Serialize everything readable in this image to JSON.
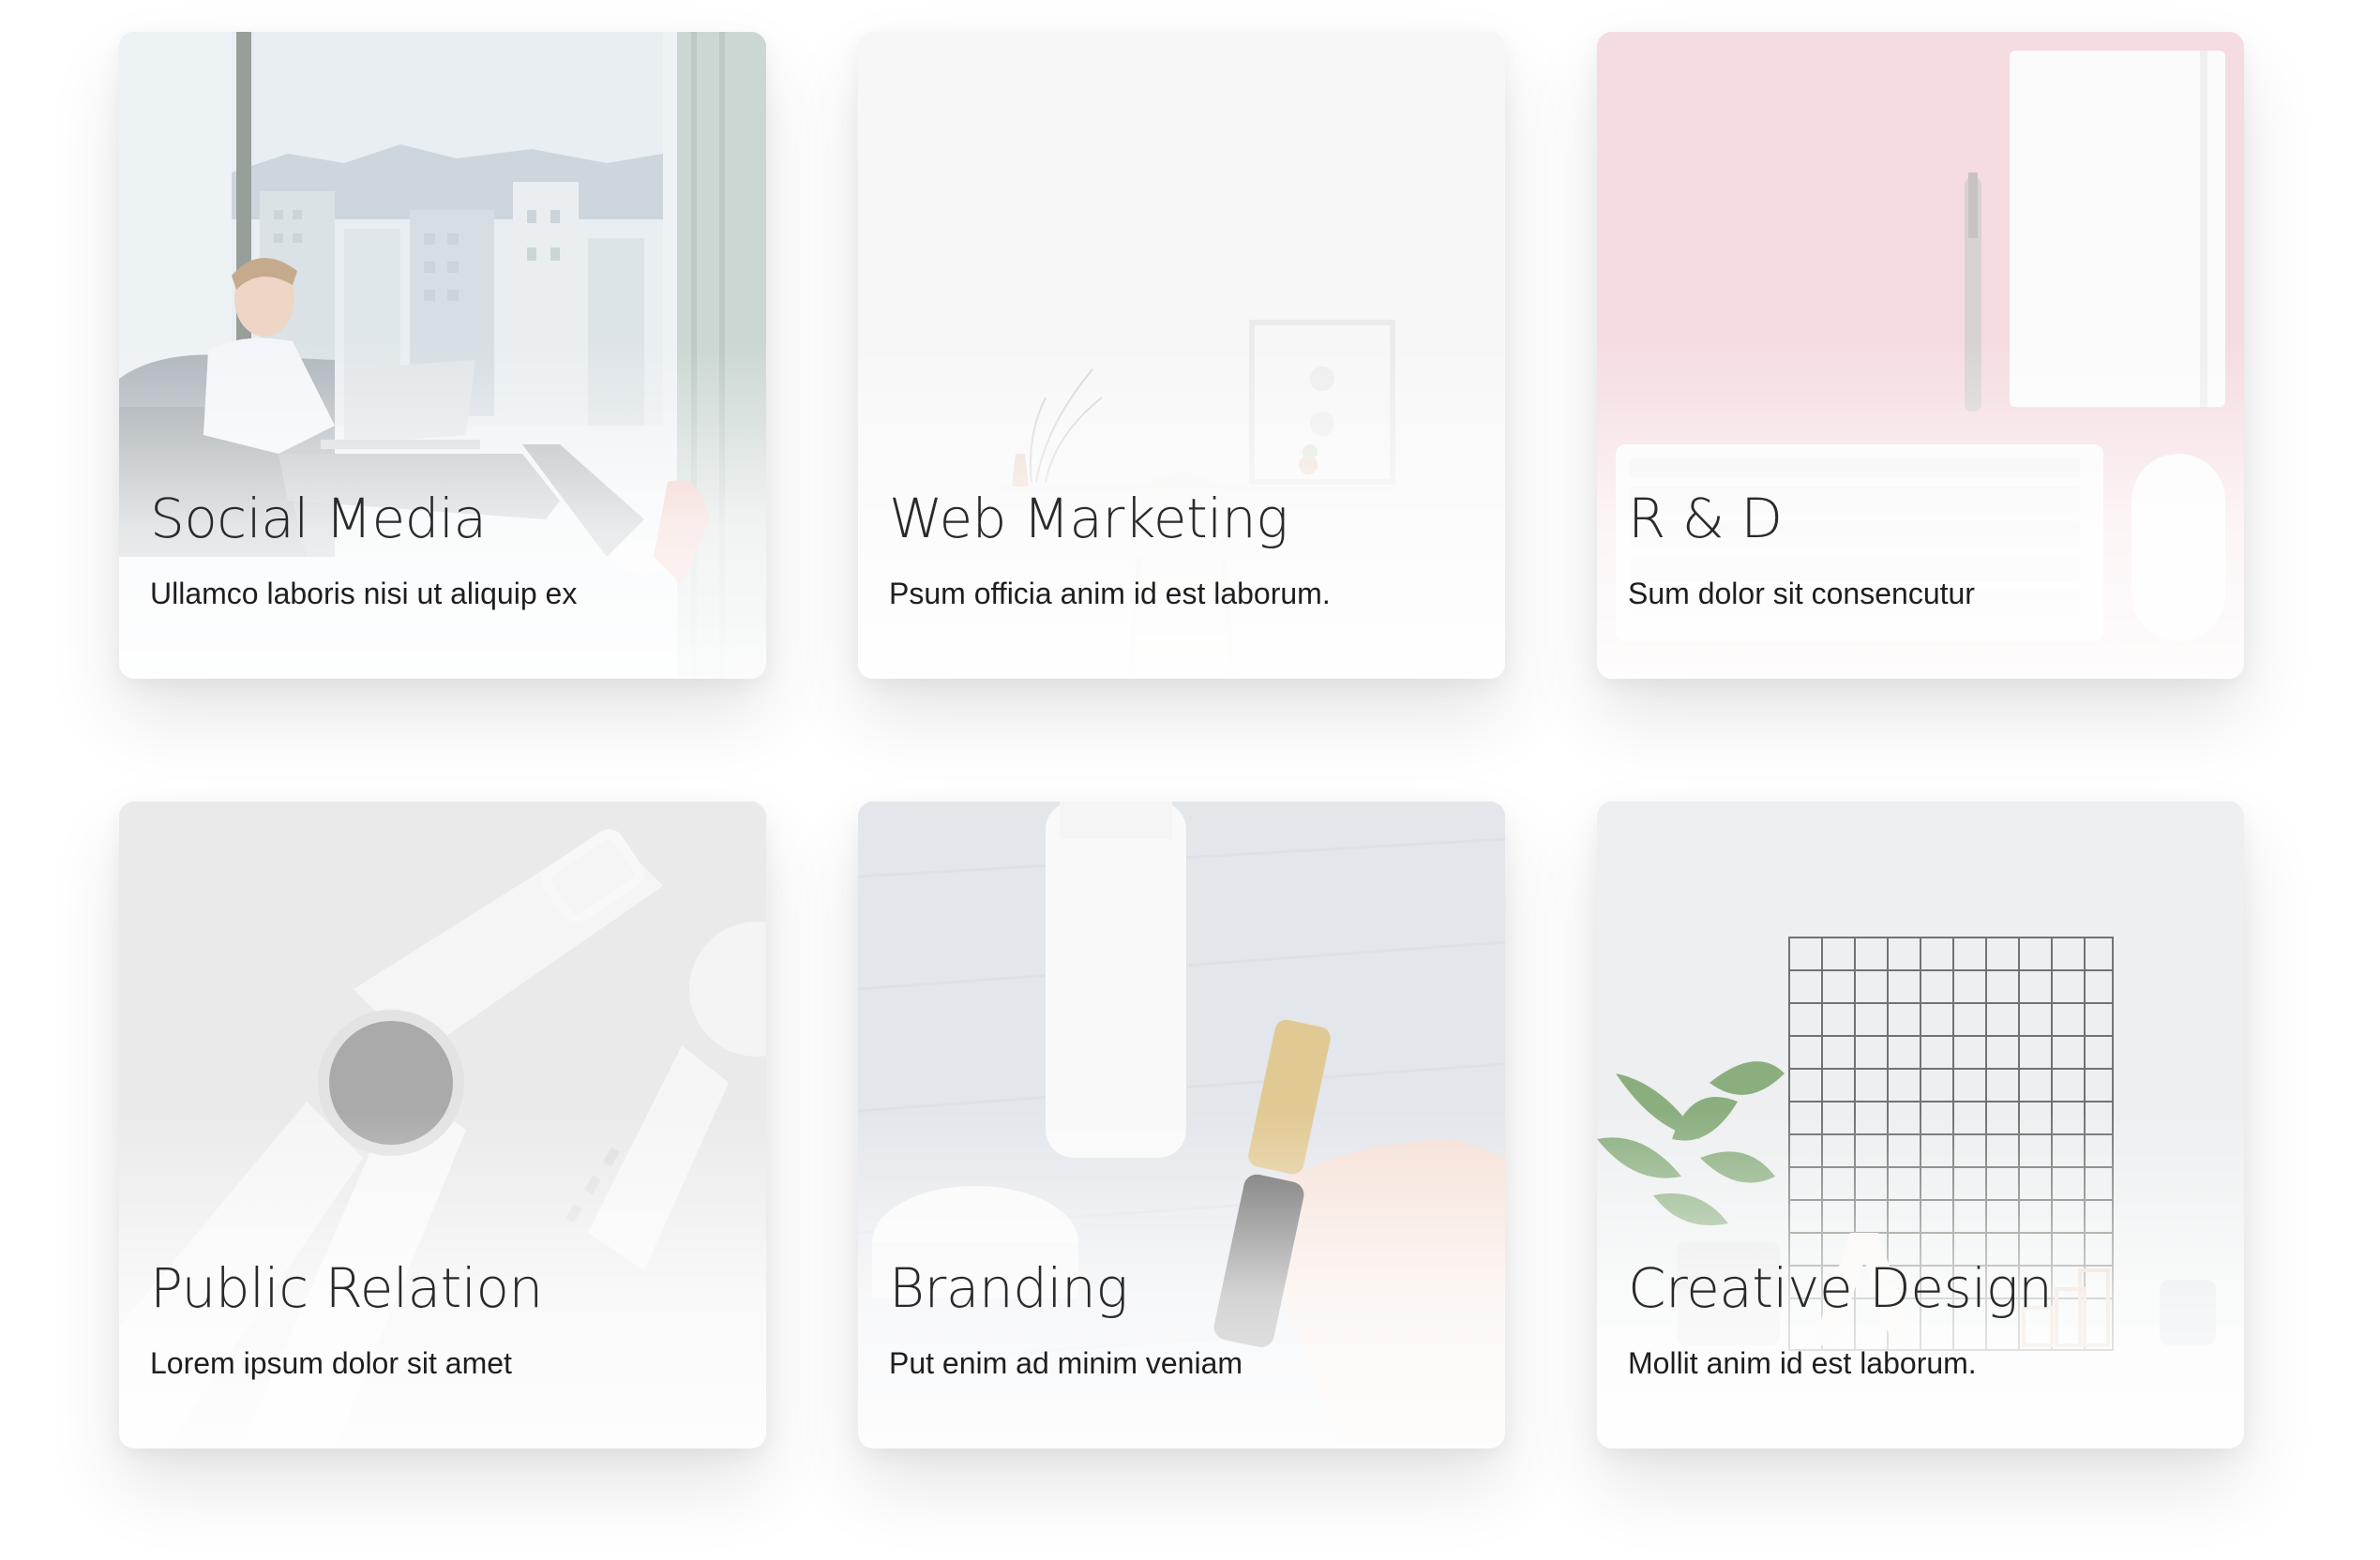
{
  "cards": [
    {
      "title": "Social Media",
      "description": "Ullamco laboris nisi ut aliquip ex",
      "image": "man-with-laptop-by-window"
    },
    {
      "title": "Web Marketing",
      "description": "Psum officia anim id est laborum.",
      "image": "white-desk-with-frame-and-plant"
    },
    {
      "title": "R & D",
      "description": "Sum dolor sit consencutur",
      "image": "keyboard-notebook-on-pink-desk"
    },
    {
      "title": "Public Relation",
      "description": "Lorem ipsum dolor sit amet",
      "image": "white-smartwatch"
    },
    {
      "title": "Branding",
      "description": "Put enim ad minim veniam",
      "image": "cosmetics-bottles-in-hand"
    },
    {
      "title": "Creative Design",
      "description": "Mollit anim id est laborum.",
      "image": "wire-grid-with-plant"
    }
  ],
  "colors": {
    "card_background": "#f3f3f4",
    "title_text": "#2a2a2a",
    "description_text": "#1e1e1e",
    "pink_desk": "#f2cfd4"
  }
}
